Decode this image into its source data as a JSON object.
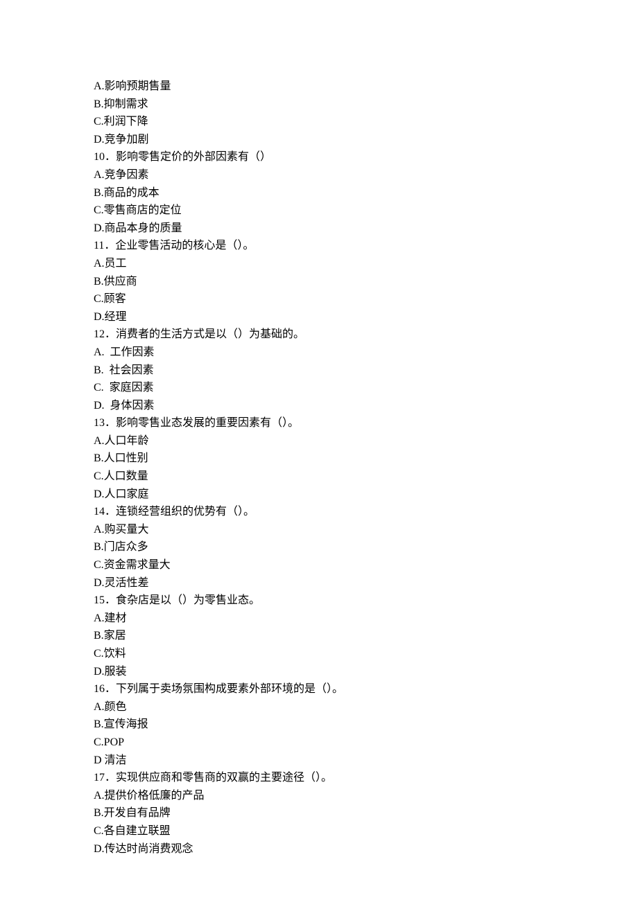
{
  "lines": [
    "A.影响预期售量",
    "B.抑制需求",
    "C.利润下降",
    "D.竞争加剧",
    "10．影响零售定价的外部因素有（）",
    "A.竞争因素",
    "B.商品的成本",
    "C.零售商店的定位",
    "D.商品本身的质量",
    "11．企业零售活动的核心是（）。",
    "A.员工",
    "B.供应商",
    "C.顾客",
    "D.经理",
    "12．消费者的生活方式是以（）为基础的。",
    "A.  工作因素",
    "B.  社会因素",
    "C.  家庭因素",
    "D.  身体因素",
    "13．影响零售业态发展的重要因素有（）。",
    "A.人口年龄",
    "B.人口性别",
    "C.人口数量",
    "D.人口家庭",
    "14．连锁经营组织的优势有（）。",
    "A.购买量大",
    "B.门店众多",
    "C.资金需求量大",
    "D.灵活性差",
    "15．食杂店是以（）为零售业态。",
    "A.建材",
    "B.家居",
    "C.饮料",
    "D.服装",
    "16．下列属于卖场氛围构成要素外部环境的是（）。",
    "A.颜色",
    "B.宣传海报",
    "C.POP",
    "D 清洁",
    "17．实现供应商和零售商的双赢的主要途径（）。",
    "A.提供价格低廉的产品",
    "B.开发自有品牌",
    "C.各自建立联盟",
    "D.传达时尚消费观念"
  ]
}
